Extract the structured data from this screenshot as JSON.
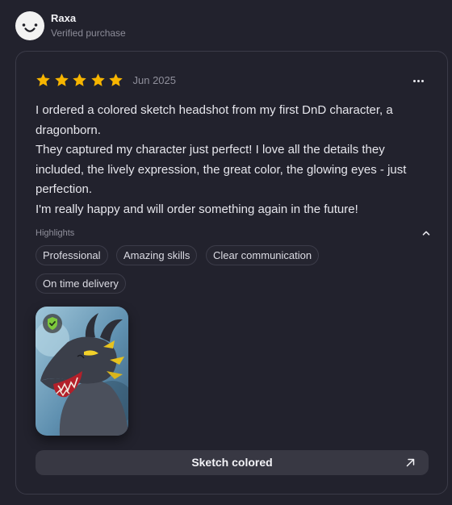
{
  "reviewer": {
    "name": "Raxa",
    "status": "Verified purchase",
    "avatar_icon": "smiley-face-icon"
  },
  "review": {
    "rating": 5,
    "rating_max": 5,
    "date": "Jun 2025",
    "paragraphs": [
      "I ordered a colored sketch headshot from my first DnD character, a dragonborn.",
      "They captured my character just perfect! I love all the details they included, the lively expression, the great color, the glowing eyes - just perfection.",
      "I'm really happy and will order something again in the future!"
    ]
  },
  "highlights": {
    "label": "Highlights",
    "chips": [
      "Professional",
      "Amazing skills",
      "Clear communication",
      "On time delivery"
    ]
  },
  "attachment": {
    "badge_icon": "verified-shield-icon",
    "subject_icon": "dragon-portrait-image"
  },
  "action": {
    "label": "Sketch colored",
    "icon": "arrow-up-right-icon"
  },
  "colors": {
    "background": "#22222d",
    "star": "#f7b500",
    "badge_green": "#7dc93c",
    "button": "#383843"
  }
}
